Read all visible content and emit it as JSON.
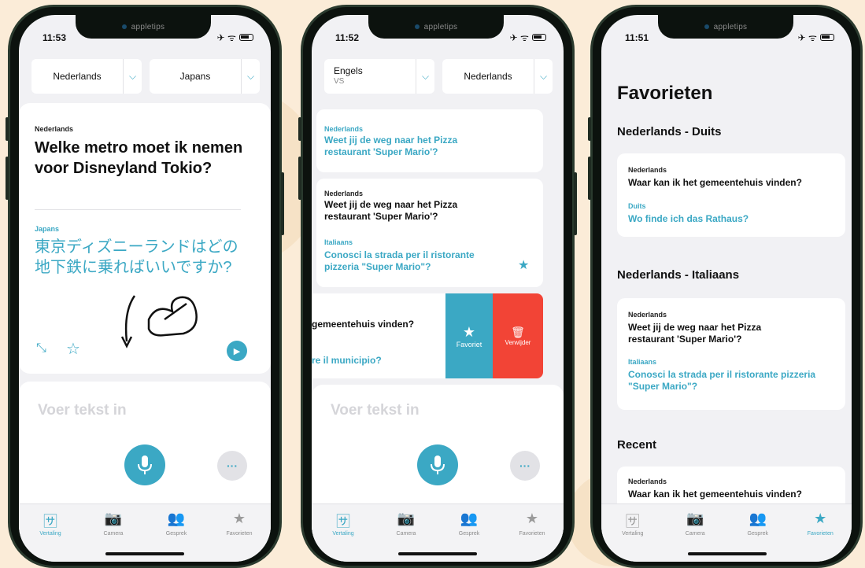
{
  "status": {
    "time_1": "11:53",
    "time_2": "11:52",
    "time_3": "11:51",
    "brand": "appletips",
    "icons": "✈ ᯤ"
  },
  "colors": {
    "accent": "#3ba8c4",
    "delete": "#f24436",
    "background": "#fbecd8"
  },
  "phone1": {
    "source_lang": "Nederlands",
    "target_lang": "Japans",
    "source_label": "Nederlands",
    "source_text": "Welke metro moet ik nemen voor Disneyland Tokio?",
    "target_label": "Japans",
    "target_text": "東京ディズニーランドはどの地下鉄に乗ればいいですか?",
    "placeholder": "Voer tekst in",
    "more_label": "···"
  },
  "phone2": {
    "source_lang": "Engels",
    "source_region": "VS",
    "target_lang": "Nederlands",
    "card1": {
      "label": "Nederlands",
      "text": "Weet jij de weg naar het Pizza restaurant 'Super Mario'?"
    },
    "card2": {
      "label": "Nederlands",
      "text": "Weet jij de weg naar het Pizza restaurant 'Super Mario'?",
      "tlabel": "Italiaans",
      "ttext": "Conosci la strada per il ristorante pizzeria \"Super Mario\"?"
    },
    "card3": {
      "text": "gemeentehuis vinden?",
      "ttext": "re il municipio?"
    },
    "fav_action": "Favoriet",
    "delete_action": "Verwijder",
    "placeholder": "Voer tekst in",
    "more_label": "···"
  },
  "phone3": {
    "title": "Favorieten",
    "section1": "Nederlands - Duits",
    "fav1": {
      "label": "Nederlands",
      "text": "Waar kan ik het gemeentehuis vinden?",
      "tlabel": "Duits",
      "ttext": "Wo finde ich das Rathaus?"
    },
    "section2": "Nederlands - Italiaans",
    "fav2": {
      "label": "Nederlands",
      "text": "Weet jij de weg naar het Pizza restaurant 'Super Mario'?",
      "tlabel": "Italiaans",
      "ttext": "Conosci la strada per il ristorante pizzeria \"Super Mario\"?"
    },
    "section3": "Recent",
    "recent1": {
      "label": "Nederlands",
      "text": "Waar kan ik het gemeentehuis vinden?"
    }
  },
  "tabs": [
    {
      "label": "Vertaling",
      "icon": "translate-icon"
    },
    {
      "label": "Camera",
      "icon": "camera-icon"
    },
    {
      "label": "Gesprek",
      "icon": "conversation-icon"
    },
    {
      "label": "Favorieten",
      "icon": "star-icon"
    }
  ]
}
